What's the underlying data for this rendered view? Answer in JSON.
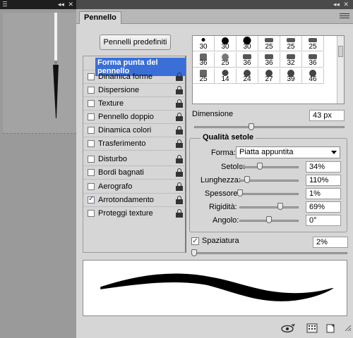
{
  "panel": {
    "title": "Pennello"
  },
  "presets_button": "Pennelli predefiniti",
  "options": [
    {
      "label": "Forma punta del pennello",
      "selected": true,
      "has_checkbox": false,
      "checked": false,
      "locked": false
    },
    {
      "label": "Dinamica forme",
      "checked": false,
      "locked": true
    },
    {
      "label": "Dispersione",
      "checked": false,
      "locked": true
    },
    {
      "label": "Texture",
      "checked": false,
      "locked": true
    },
    {
      "label": "Pennello doppio",
      "checked": false,
      "locked": true
    },
    {
      "label": "Dinamica colori",
      "checked": false,
      "locked": true
    },
    {
      "label": "Trasferimento",
      "checked": false,
      "locked": true
    },
    {
      "label": "Disturbo",
      "checked": false,
      "locked": true
    },
    {
      "label": "Bordi bagnati",
      "checked": false,
      "locked": true
    },
    {
      "label": "Aerografo",
      "checked": false,
      "locked": true
    },
    {
      "label": "Arrotondamento",
      "checked": true,
      "locked": true
    },
    {
      "label": "Proteggi texture",
      "checked": false,
      "locked": true
    }
  ],
  "brush_sizes": [
    "30",
    "30",
    "30",
    "25",
    "25",
    "25",
    "36",
    "25",
    "36",
    "36",
    "32",
    "36",
    "25",
    "14",
    "24",
    "27",
    "39",
    "46"
  ],
  "dimensione": {
    "label": "Dimensione",
    "value": "43 px",
    "level": 0.38
  },
  "qualita": {
    "title": "Qualità setole",
    "forma_label": "Forma:",
    "forma_value": "Piatta appuntita",
    "rows": [
      {
        "label": "Setole:",
        "value": "34%",
        "level": 0.34
      },
      {
        "label": "Lunghezza:",
        "value": "110%",
        "level": 0.13
      },
      {
        "label": "Spessore:",
        "value": "1%",
        "level": 0.01
      },
      {
        "label": "Rigidità:",
        "value": "69%",
        "level": 0.69
      },
      {
        "label": "Angolo:",
        "value": "0°",
        "level": 0.5
      }
    ]
  },
  "spaziatura": {
    "label": "Spaziatura",
    "value": "2%",
    "checked": true,
    "level": 0.02
  },
  "icons": [
    "brush-preview-eye-icon",
    "grid-icon",
    "new-preset-icon"
  ]
}
